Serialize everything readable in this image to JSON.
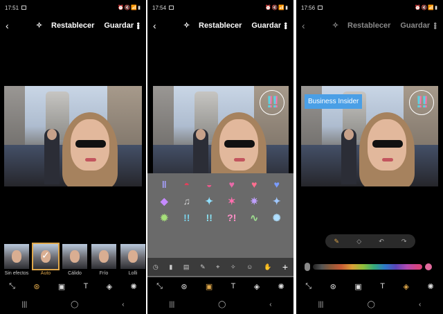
{
  "colors": {
    "accent": "#e0a84b",
    "textbox_bg": "#4a9fe6",
    "panel_bg": "#6a6a6a"
  },
  "screens": [
    {
      "status_time": "17:51",
      "topbar": {
        "reset_label": "Restablecer",
        "save_label": "Guardar"
      },
      "filters": [
        {
          "label": "Sin efectos",
          "active": false
        },
        {
          "label": "Auto",
          "active": true
        },
        {
          "label": "Cálido",
          "active": false
        },
        {
          "label": "Frío",
          "active": false
        },
        {
          "label": "Lolli",
          "active": false
        }
      ]
    },
    {
      "status_time": "17:54",
      "topbar": {
        "reset_label": "Restablecer",
        "save_label": "Guardar"
      }
    },
    {
      "status_time": "17:56",
      "topbar": {
        "reset_label": "Restablecer",
        "save_label": "Guardar"
      },
      "text_overlay": "Business Insider"
    }
  ]
}
